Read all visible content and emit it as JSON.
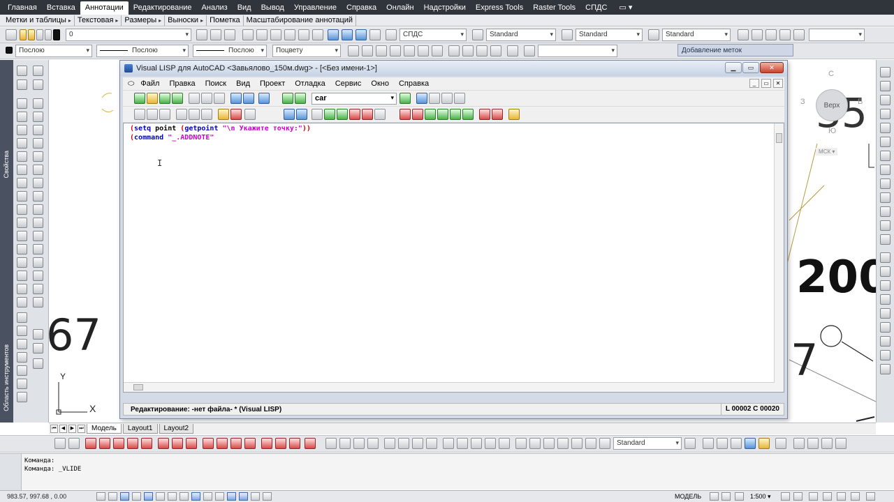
{
  "ribbon": {
    "tabs": [
      "Главная",
      "Вставка",
      "Аннотации",
      "Редактирование",
      "Анализ",
      "Вид",
      "Вывод",
      "Управление",
      "Справка",
      "Онлайн",
      "Надстройки",
      "Express Tools",
      "Raster Tools",
      "СПДС"
    ],
    "active_tab": "Аннотации",
    "extra": "▭ ▾"
  },
  "panels": [
    "Метки и таблицы",
    "Текстовая",
    "Размеры",
    "Выноски",
    "Пометка",
    "Масштабирование аннотаций"
  ],
  "toolbar1": {
    "layer_value": "0",
    "text_style": "СПДС",
    "dim_style": "Standard",
    "table_style": "Standard",
    "mleader_style": "Standard"
  },
  "toolbar2": {
    "color": "Послою",
    "linetype": "Послою",
    "lineweight": "Послою",
    "plotstyle": "Поцвету",
    "addnote_tip": "Добавление меток"
  },
  "side_labels": {
    "properties": "Свойства",
    "tool_palettes": "Область инструментов"
  },
  "viewcube": {
    "top": "Верх",
    "north": "С",
    "south": "Ю",
    "west": "З",
    "east": "В",
    "ucs": "МСК ▾"
  },
  "drawing_text": {
    "num1": "200",
    "num2": "67",
    "num3": "35",
    "num4": "7",
    "axis_x": "X",
    "axis_y": "Y"
  },
  "vlisp": {
    "title": "Visual LISP для AutoCAD <Завьялово_150м.dwg> - [<Без имени-1>]",
    "menu": [
      "Файл",
      "Правка",
      "Поиск",
      "Вид",
      "Проект",
      "Отладка",
      "Сервис",
      "Окно",
      "Справка"
    ],
    "search_value": "car",
    "code": {
      "line1": {
        "p1": "(",
        "fn1": "setq",
        "sym1": " point ",
        "p2": "(",
        "fn2": "getpoint",
        "sp": " ",
        "str1": "\"\\n Укажите точку:\"",
        "p3": "))"
      },
      "line2": {
        "p1": "(",
        "fn1": "command",
        "sp": " ",
        "str1": "\"_.ADDNOTE\""
      }
    },
    "status_left": "Редактирование:  -нет файла- *  (Visual LISP)",
    "status_right": "L 00002  C 00020"
  },
  "layout_tabs": {
    "tabs": [
      "Модель",
      "Layout1",
      "Layout2"
    ],
    "active": "Модель"
  },
  "bottom_toolbar": {
    "style": "Standard"
  },
  "command_line": {
    "line1": "Команда:",
    "line2": "Команда: _VLIDE"
  },
  "statusbar": {
    "coords": "983.57, 997.68 , 0.00",
    "model": "МОДЕЛЬ",
    "scale": "1:500 ▾"
  }
}
